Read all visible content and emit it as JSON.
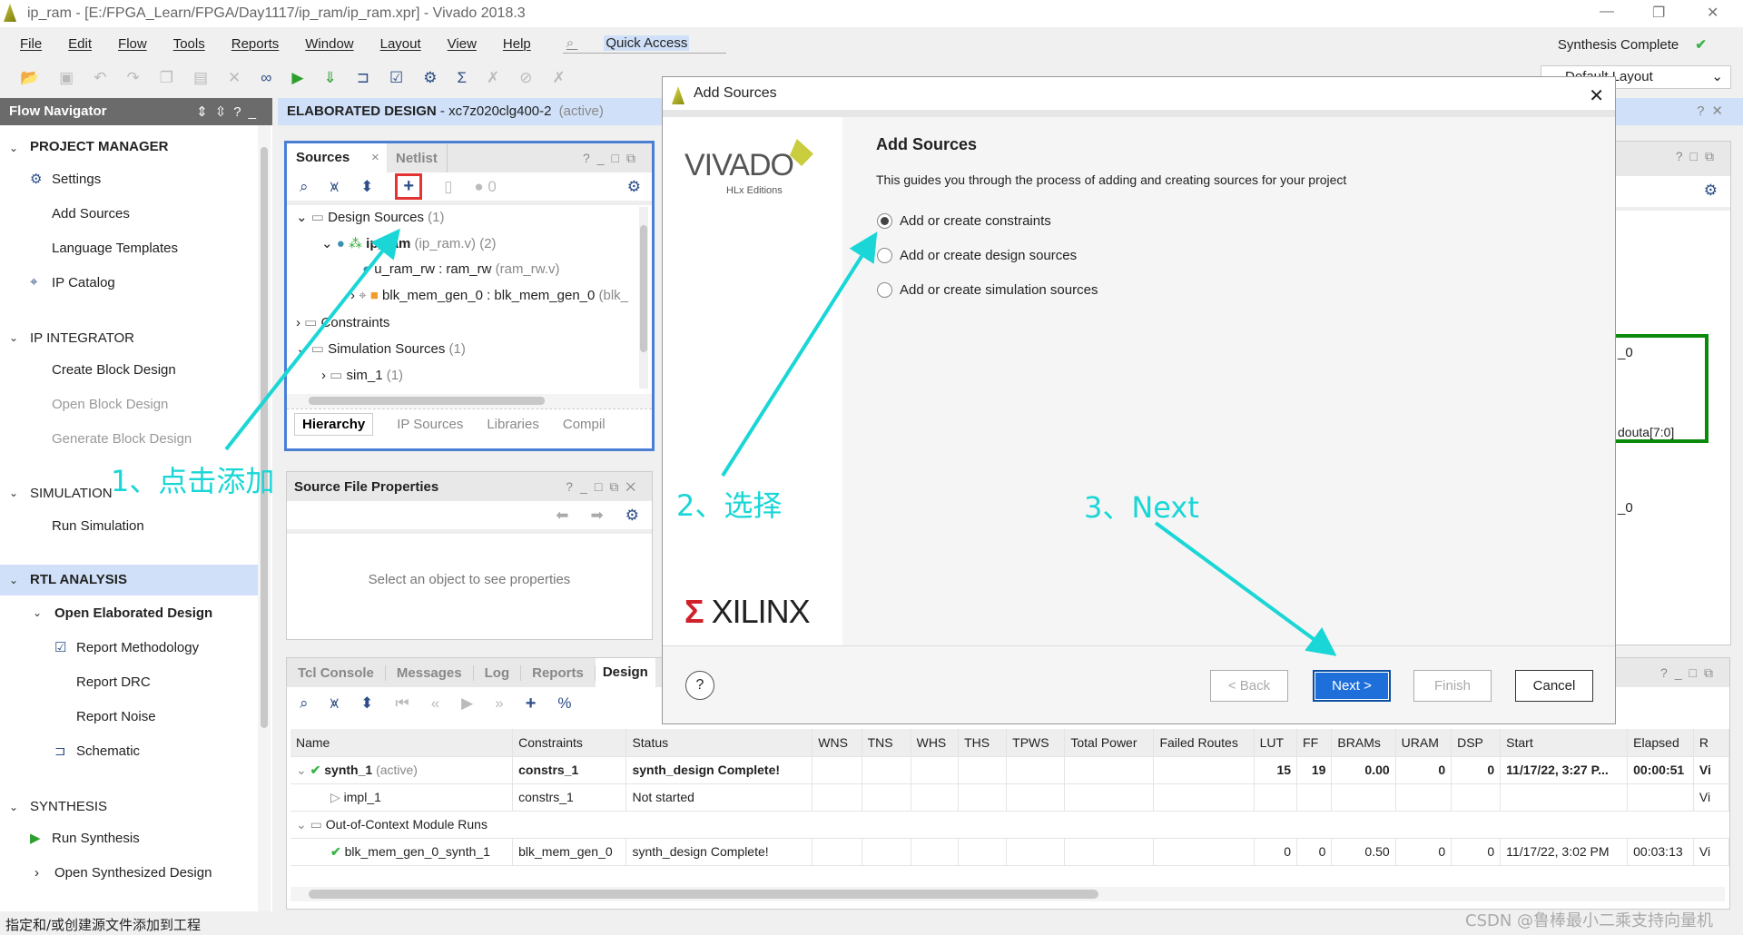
{
  "window": {
    "title": "ip_ram - [E:/FPGA_Learn/FPGA/Day1117/ip_ram/ip_ram.xpr] - Vivado 2018.3"
  },
  "menu": [
    "File",
    "Edit",
    "Flow",
    "Tools",
    "Reports",
    "Window",
    "Layout",
    "View",
    "Help"
  ],
  "quick_access": "Quick Access",
  "status_right": "Synthesis Complete",
  "layout_select": "Default Layout",
  "flow_nav": {
    "title": "Flow Navigator",
    "project_manager": "PROJECT MANAGER",
    "settings": "Settings",
    "add_sources": "Add Sources",
    "language_templates": "Language Templates",
    "ip_catalog": "IP Catalog",
    "ip_integrator": "IP INTEGRATOR",
    "create_bd": "Create Block Design",
    "open_bd": "Open Block Design",
    "generate_bd": "Generate Block Design",
    "simulation": "SIMULATION",
    "run_sim": "Run Simulation",
    "rtl_analysis": "RTL ANALYSIS",
    "open_elab": "Open Elaborated Design",
    "report_meth": "Report Methodology",
    "report_drc": "Report DRC",
    "report_noise": "Report Noise",
    "schematic": "Schematic",
    "synthesis": "SYNTHESIS",
    "run_synth": "Run Synthesis",
    "open_synth": "Open Synthesized Design"
  },
  "main_header": {
    "title": "ELABORATED DESIGN",
    "part": " - xc7z020clg400-2",
    "state": "(active)"
  },
  "sources": {
    "tab1": "Sources",
    "tab2": "Netlist",
    "count": "0",
    "tree": {
      "design_sources": "Design Sources",
      "design_count": "(1)",
      "top": "ip_ram",
      "top_file": "(ip_ram.v) (2)",
      "u1": "u_ram_rw : ram_rw",
      "u1_file": "(ram_rw.v)",
      "u2": "blk_mem_gen_0 : blk_mem_gen_0",
      "u2_file": "(blk_",
      "constraints": "Constraints",
      "sim_sources": "Simulation Sources",
      "sim_count": "(1)",
      "sim1": "sim_1",
      "sim1_count": "(1)"
    },
    "bottom_tabs": [
      "Hierarchy",
      "IP Sources",
      "Libraries",
      "Compil"
    ]
  },
  "props": {
    "title": "Source File Properties",
    "empty": "Select an object to see properties"
  },
  "bottom": {
    "tabs": [
      "Tcl Console",
      "Messages",
      "Log",
      "Reports",
      "Design"
    ],
    "columns": [
      "Name",
      "Constraints",
      "Status",
      "WNS",
      "TNS",
      "WHS",
      "THS",
      "TPWS",
      "Total Power",
      "Failed Routes",
      "LUT",
      "FF",
      "BRAMs",
      "URAM",
      "DSP",
      "Start",
      "Elapsed",
      "R"
    ],
    "rows": [
      {
        "name": "synth_1",
        "tag": "(active)",
        "constraints": "constrs_1",
        "status": "synth_design Complete!",
        "lut": "15",
        "ff": "19",
        "brams": "0.00",
        "uram": "0",
        "dsp": "0",
        "start": "11/17/22, 3:27 P...",
        "elapsed": "00:00:51",
        "r": "Vi"
      },
      {
        "name": "impl_1",
        "constraints": "constrs_1",
        "status": "Not started",
        "r": "Vi"
      },
      {
        "name": "Out-of-Context Module Runs"
      },
      {
        "name": "blk_mem_gen_0_synth_1",
        "constraints": "blk_mem_gen_0",
        "status": "synth_design Complete!",
        "lut": "0",
        "ff": "0",
        "brams": "0.50",
        "uram": "0",
        "dsp": "0",
        "start": "11/17/22, 3:02 PM",
        "elapsed": "00:03:13",
        "r": "Vi"
      }
    ]
  },
  "schematic": {
    "label1": "_0",
    "label2": "douta[7:0]",
    "label3": "_0"
  },
  "dialog": {
    "title": "Add Sources",
    "heading": "Add Sources",
    "desc": "This guides you through the process of adding and creating sources for your project",
    "options": [
      "Add or create constraints",
      "Add or create design sources",
      "Add or create simulation sources"
    ],
    "selected": 0,
    "back": "< Back",
    "next": "Next >",
    "finish": "Finish",
    "cancel": "Cancel",
    "logo_vivado": "VIVADO",
    "logo_hlx": "HLx Editions",
    "logo_xilinx": "XILINX"
  },
  "annotations": {
    "a1": "1、点击添加",
    "a2": "2、选择",
    "a3": "3、Next"
  },
  "statusbar": "指定和/或创建源文件添加到工程",
  "watermark": "CSDN @鲁棒最小二乘支持向量机",
  "colors": {
    "annotation": "#1ad6d6",
    "accent": "#2d4e87",
    "highlight": "#cfe0f8",
    "next_button": "#1e6fd9"
  }
}
